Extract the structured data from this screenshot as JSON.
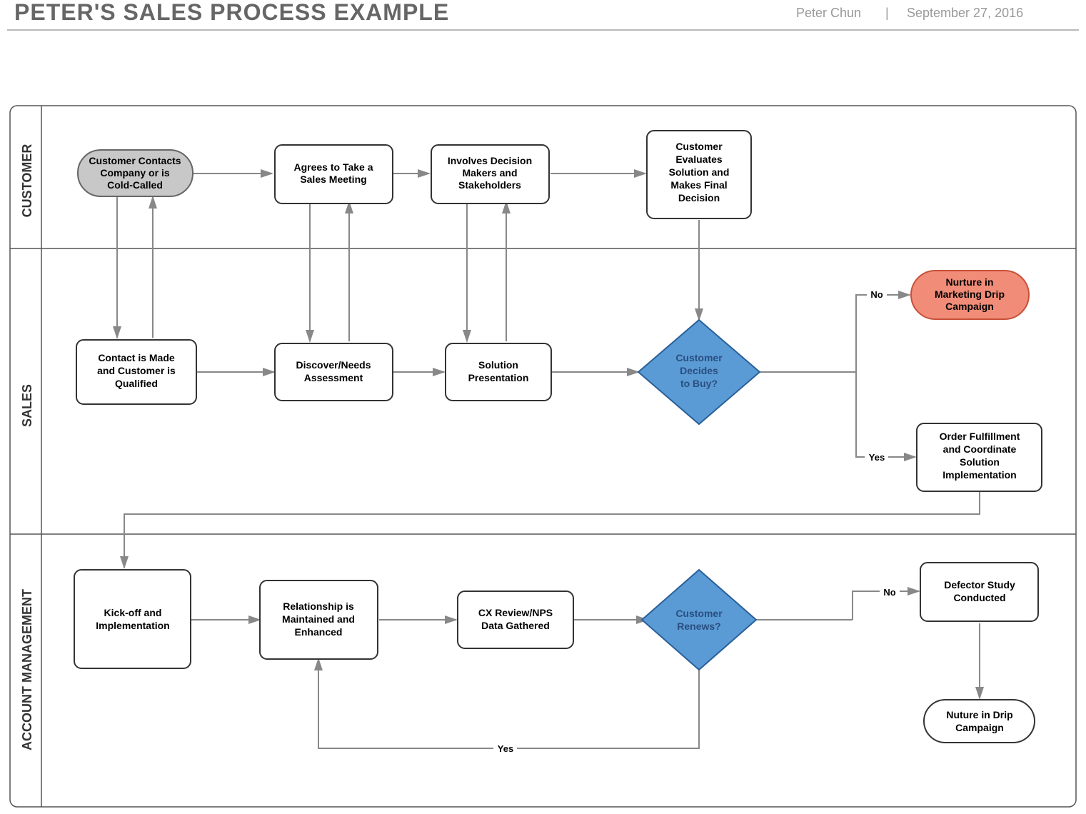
{
  "header": {
    "title": "PETER'S SALES PROCESS EXAMPLE",
    "author": "Peter Chun",
    "divider": "|",
    "date": "September 27, 2016"
  },
  "lanes": {
    "customer": "CUSTOMER",
    "sales": "SALES",
    "account": "ACCOUNT MANAGEMENT"
  },
  "nodes": {
    "start": {
      "l1": "Customer Contacts",
      "l2": "Company or is",
      "l3": "Cold-Called"
    },
    "c_agrees": {
      "l1": "Agrees to Take a",
      "l2": "Sales Meeting"
    },
    "c_involves": {
      "l1": "Involves Decision",
      "l2": "Makers and",
      "l3": "Stakeholders"
    },
    "c_eval": {
      "l1": "Customer",
      "l2": "Evaluates",
      "l3": "Solution and",
      "l4": "Makes Final",
      "l5": "Decision"
    },
    "s_contact": {
      "l1": "Contact is Made",
      "l2": "and Customer is",
      "l3": "Qualified"
    },
    "s_discover": {
      "l1": "Discover/Needs",
      "l2": "Assessment"
    },
    "s_solution": {
      "l1": "Solution",
      "l2": "Presentation"
    },
    "s_decides": {
      "l1": "Customer",
      "l2": "Decides",
      "l3": "to Buy?"
    },
    "s_nurture": {
      "l1": "Nurture in",
      "l2": "Marketing Drip",
      "l3": "Campaign"
    },
    "s_order": {
      "l1": "Order Fulfillment",
      "l2": "and Coordinate",
      "l3": "Solution",
      "l4": "Implementation"
    },
    "a_kick": {
      "l1": "Kick-off and",
      "l2": "Implementation"
    },
    "a_rel": {
      "l1": "Relationship is",
      "l2": "Maintained and",
      "l3": "Enhanced"
    },
    "a_cx": {
      "l1": "CX Review/NPS",
      "l2": "Data Gathered"
    },
    "a_renew": {
      "l1": "Customer",
      "l2": "Renews?"
    },
    "a_defect": {
      "l1": "Defector Study",
      "l2": "Conducted"
    },
    "a_nurt": {
      "l1": "Nuture in Drip",
      "l2": "Campaign"
    }
  },
  "labels": {
    "no": "No",
    "yes": "Yes",
    "no2": "No",
    "yes2": "Yes"
  }
}
